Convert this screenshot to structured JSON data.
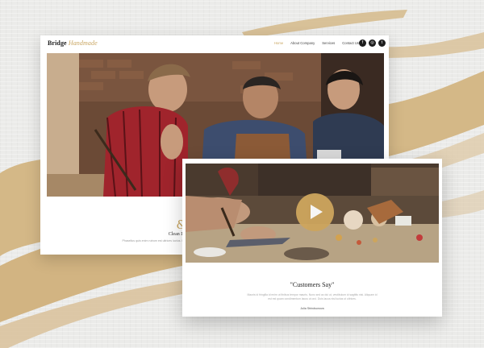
{
  "colors": {
    "accent": "#c9a560",
    "dark": "#1d1d1d",
    "background": "#ebebe9"
  },
  "site": {
    "logo_bold": "Bridge",
    "logo_script": "Handmade",
    "menu": [
      "Home",
      "About Company",
      "Services",
      "Contact Us"
    ],
    "socials": [
      {
        "icon": "facebook-icon",
        "glyph": "f"
      },
      {
        "icon": "instagram-icon",
        "glyph": "◎"
      },
      {
        "icon": "twitter-icon",
        "glyph": "t"
      }
    ]
  },
  "design": {
    "icon": "signature-icon",
    "glyph": "&",
    "title": "Clean Design",
    "text": "Phasellus quis enim rutrum est ultrices luctus. In porta dictum. Phasellus ac interdum neque."
  },
  "video": {
    "icon": "play-icon"
  },
  "testimonial": {
    "title": "\"Customers Say\"",
    "text": "Mauris id fringilla id enim ut finibus tempor mauris. Nunc sed ac dui ut, vestibulum id sagittis nisi. Aliquam id est est quam condimentum lacus ut orci. Duis lacus nisi luctus ut ultrices.",
    "author": "Julia Strindsonova"
  }
}
